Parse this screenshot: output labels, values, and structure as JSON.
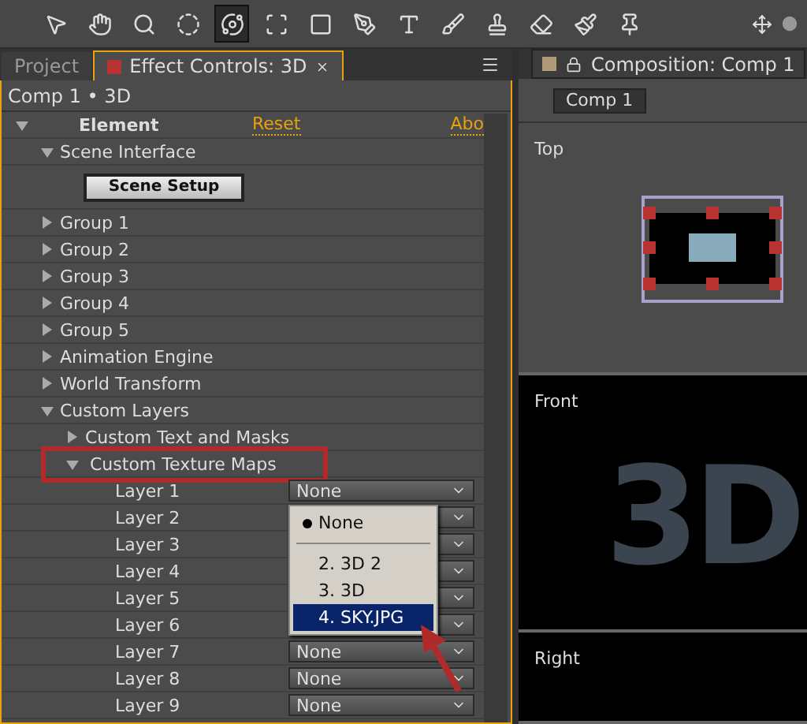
{
  "toolbar": {
    "tools": [
      {
        "kind": "pointer",
        "selected": false
      },
      {
        "kind": "hand",
        "selected": false
      },
      {
        "kind": "zoom",
        "selected": false
      },
      {
        "kind": "orbit",
        "selected": false
      },
      {
        "kind": "track",
        "selected": true
      },
      {
        "kind": "pan",
        "selected": false
      },
      {
        "kind": "rect",
        "selected": false
      },
      {
        "kind": "pen",
        "selected": false
      },
      {
        "kind": "type",
        "selected": false
      },
      {
        "kind": "brush",
        "selected": false
      },
      {
        "kind": "stamp",
        "selected": false
      },
      {
        "kind": "eraser",
        "selected": false
      },
      {
        "kind": "roto",
        "selected": false
      },
      {
        "kind": "pin",
        "selected": false
      }
    ]
  },
  "left_panel": {
    "tabs": [
      {
        "label": "Project",
        "selected": false
      },
      {
        "label": "Effect Controls: 3D",
        "selected": true
      }
    ],
    "breadcrumb": "Comp 1 • 3D",
    "effect": {
      "name": "Element",
      "reset": "Reset",
      "about": "Abo",
      "expanded": true
    },
    "tree": [
      {
        "label": "Scene Interface",
        "expanded": true,
        "button": "Scene Setup"
      },
      {
        "label": "Group 1",
        "expanded": false
      },
      {
        "label": "Group 2",
        "expanded": false
      },
      {
        "label": "Group 3",
        "expanded": false
      },
      {
        "label": "Group 4",
        "expanded": false
      },
      {
        "label": "Group 5",
        "expanded": false
      },
      {
        "label": "Animation Engine",
        "expanded": false
      },
      {
        "label": "World Transform",
        "expanded": false
      },
      {
        "label": "Custom Layers",
        "expanded": true,
        "children": [
          {
            "label": "Custom Text and Masks",
            "expanded": false,
            "highlighted": false
          },
          {
            "label": "Custom Texture Maps",
            "expanded": true,
            "highlighted": true,
            "children": [
              {
                "label": "Layer 1",
                "value": "None"
              },
              {
                "label": "Layer 2"
              },
              {
                "label": "Layer 3"
              },
              {
                "label": "Layer 4"
              },
              {
                "label": "Layer 5"
              },
              {
                "label": "Layer 6"
              },
              {
                "label": "Layer 7",
                "value": "None"
              },
              {
                "label": "Layer 8",
                "value": "None"
              },
              {
                "label": "Layer 9",
                "value": "None"
              }
            ]
          }
        ]
      }
    ],
    "dropdown_menu": {
      "items": [
        {
          "label": "None",
          "checked": true,
          "selected": false,
          "separator_after": true
        },
        {
          "label": "2. 3D 2",
          "checked": false,
          "selected": false,
          "separator_after": false
        },
        {
          "label": "3. 3D",
          "checked": false,
          "selected": false,
          "separator_after": false
        },
        {
          "label": "4. SKY.JPG",
          "checked": false,
          "selected": true,
          "separator_after": false
        }
      ]
    }
  },
  "right_panel": {
    "tab": "Composition: Comp 1",
    "comp_button": "Comp 1",
    "views": [
      {
        "label": "Top",
        "kind": "top"
      },
      {
        "label": "Front",
        "kind": "front",
        "text": "3D"
      },
      {
        "label": "Right",
        "kind": "right"
      }
    ]
  }
}
